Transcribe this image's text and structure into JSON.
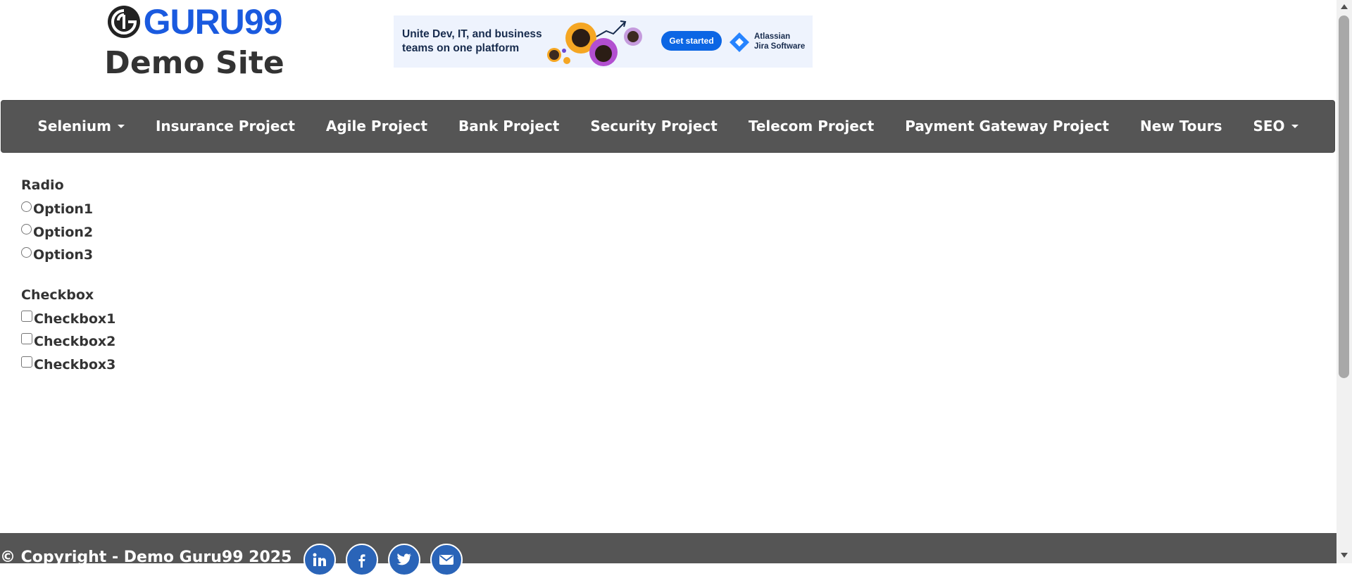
{
  "header": {
    "logo_text": "GURU99",
    "site_title": "Demo Site"
  },
  "ad": {
    "headline_line1": "Unite Dev, IT, and business",
    "headline_line2": "teams on one platform",
    "cta_label": "Get started",
    "brand_line1": "Atlassian",
    "brand_line2": "Jira Software",
    "colors": {
      "background": "#eef3fd",
      "button": "#0c66e4",
      "brand": "#2684ff"
    }
  },
  "nav": {
    "items": [
      {
        "label": "Selenium",
        "dropdown": true
      },
      {
        "label": "Insurance Project",
        "dropdown": false
      },
      {
        "label": "Agile Project",
        "dropdown": false
      },
      {
        "label": "Bank Project",
        "dropdown": false
      },
      {
        "label": "Security Project",
        "dropdown": false
      },
      {
        "label": "Telecom Project",
        "dropdown": false
      },
      {
        "label": "Payment Gateway Project",
        "dropdown": false
      },
      {
        "label": "New Tours",
        "dropdown": false
      },
      {
        "label": "SEO",
        "dropdown": true
      }
    ],
    "background": "#555555"
  },
  "form": {
    "radio_label": "Radio",
    "radio_options": [
      {
        "label": "Option1",
        "checked": false
      },
      {
        "label": "Option2",
        "checked": false
      },
      {
        "label": "Option3",
        "checked": false
      }
    ],
    "checkbox_label": "Checkbox",
    "checkbox_options": [
      {
        "label": "Checkbox1",
        "checked": false
      },
      {
        "label": "Checkbox2",
        "checked": false
      },
      {
        "label": "Checkbox3",
        "checked": false
      }
    ]
  },
  "footer": {
    "copyright": "© Copyright - Demo Guru99 2025",
    "social_icons": [
      "linkedin-icon",
      "facebook-icon",
      "twitter-icon",
      "email-icon"
    ],
    "social_color": "#2a64b8"
  }
}
